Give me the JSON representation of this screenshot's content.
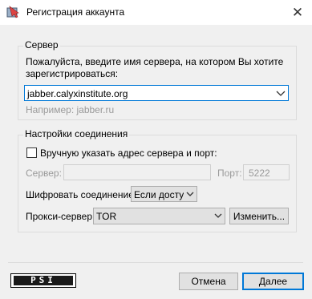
{
  "window": {
    "title": "Регистрация аккаунта"
  },
  "server_group": {
    "legend": "Сервер",
    "prompt_line1": "Пожалуйста, введите имя сервера, на котором Вы хотите",
    "prompt_line2": "зарегистрироваться:",
    "server_value": "jabber.calyxinstitute.org",
    "example": "Например: jabber.ru"
  },
  "connection_group": {
    "legend": "Настройки соединения",
    "manual_checkbox_label": "Вручную указать адрес сервера и порт:",
    "server_label": "Сервер:",
    "port_label": "Порт:",
    "port_value": "5222",
    "encrypt_label": "Шифровать соединение:",
    "encrypt_value": "Если доступ",
    "proxy_label": "Прокси-сервер:",
    "proxy_value": "TOR",
    "edit_button": "Изменить..."
  },
  "footer": {
    "logo_text": "PSI",
    "cancel_button": "Отмена",
    "next_button": "Далее"
  },
  "colors": {
    "accent": "#0078d7",
    "window_bg": "#f0f0f0"
  }
}
